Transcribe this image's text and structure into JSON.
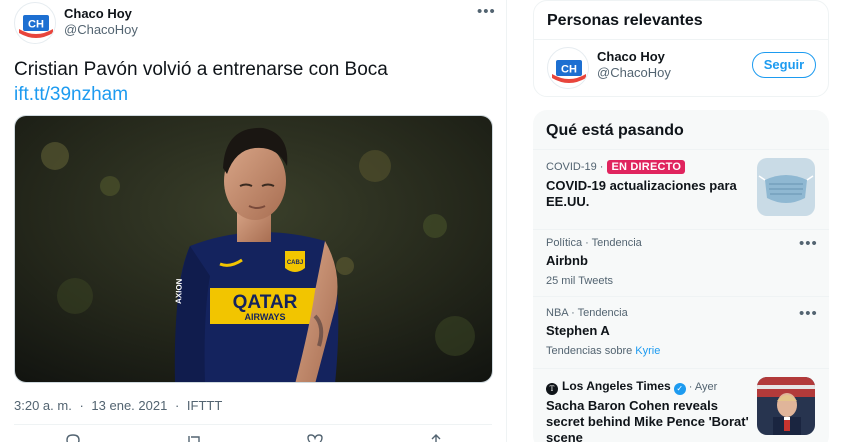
{
  "tweet": {
    "author_name": "Chaco Hoy",
    "author_handle": "@ChacoHoy",
    "avatar_text": "CH",
    "text": "Cristian Pavón volvió a entrenarse con Boca",
    "link": "ift.tt/39nzham",
    "time": "3:20 a. m.",
    "date": "13 ene. 2021",
    "source": "IFTTT",
    "separator": "·",
    "more": "•••",
    "media": {
      "kit_sponsor": "QATAR",
      "kit_sponsor_sub": "AIRWAYS",
      "kit_badge": "CABJ",
      "kit_side_brand": "AXION"
    }
  },
  "relevant": {
    "title": "Personas relevantes",
    "name": "Chaco Hoy",
    "handle": "@ChacoHoy",
    "follow_label": "Seguir"
  },
  "trends": {
    "title": "Qué está pasando",
    "items": [
      {
        "context": "COVID-19 ·",
        "badge": "EN DIRECTO",
        "name": "COVID-19 actualizaciones para EE.UU."
      },
      {
        "context": "Política · Tendencia",
        "name": "Airbnb",
        "sub": "25 mil Tweets",
        "more": "•••"
      },
      {
        "context": "NBA · Tendencia",
        "name": "Stephen A",
        "sub_prefix": "Tendencias sobre",
        "sub_keyword": "Kyrie",
        "more": "•••"
      },
      {
        "source": "Los Angeles Times",
        "source_logo": "T",
        "time": "· Ayer",
        "name": "Sacha Baron Cohen reveals secret behind Mike Pence 'Borat' scene"
      }
    ]
  },
  "colors": {
    "accent": "#1d9bf0",
    "live": "#e0245e",
    "kit_navy": "#14235e",
    "kit_gold": "#f2c500"
  },
  "icons": [
    "more-icon",
    "reply-icon",
    "retweet-icon",
    "like-icon",
    "share-icon",
    "verified-icon",
    "mask-icon"
  ]
}
